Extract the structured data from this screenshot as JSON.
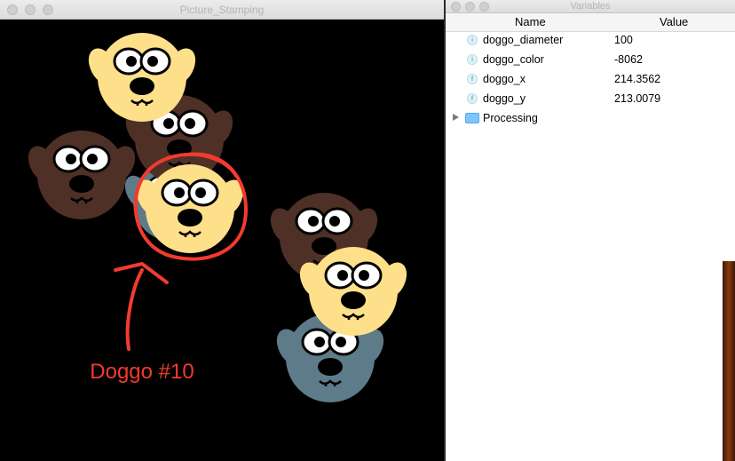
{
  "sketch_window": {
    "title": "Picture_Stamping",
    "annotation": "Doggo #10"
  },
  "variables_window": {
    "title": "Variables",
    "columns": {
      "name": "Name",
      "value": "Value"
    },
    "rows": [
      {
        "type_letter": "i",
        "name": "doggo_diameter",
        "value": "100"
      },
      {
        "type_letter": "i",
        "name": "doggo_color",
        "value": "-8062"
      },
      {
        "type_letter": "f",
        "name": "doggo_x",
        "value": "214.3562"
      },
      {
        "type_letter": "f",
        "name": "doggo_y",
        "value": "213.0079"
      }
    ],
    "folder": {
      "name": "Processing"
    }
  },
  "colors": {
    "yellow_dog": "#FFE08A",
    "brown_dog": "#4E3027",
    "slate_dog": "#5E7B8A",
    "annotation_red": "#F23B2E"
  }
}
